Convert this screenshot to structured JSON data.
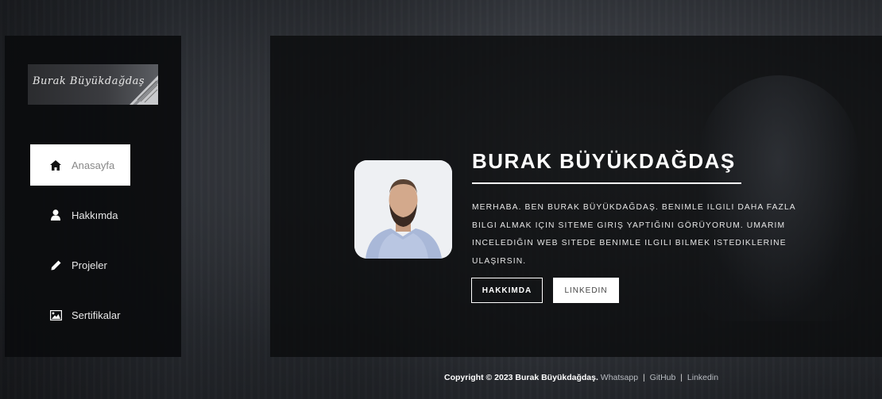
{
  "sidebar": {
    "logo_text": "Burak Büyükdağdaş",
    "items": [
      {
        "label": "Anasayfa",
        "icon": "home-icon",
        "active": true
      },
      {
        "label": "Hakkımda",
        "icon": "user-icon",
        "active": false
      },
      {
        "label": "Projeler",
        "icon": "pencil-icon",
        "active": false
      },
      {
        "label": "Sertifikalar",
        "icon": "image-icon",
        "active": false
      }
    ]
  },
  "hero": {
    "name": "BURAK BÜYÜKDAĞDAŞ",
    "description": "MERHABA. BEN BURAK BÜYÜKDAĞDAŞ. BENIMLE ILGILI DAHA FAZLA BILGI ALMAK IÇIN SITEME GIRIŞ YAPTIĞINI GÖRÜYORUM. UMARIM INCELEDIĞIN WEB SITEDE BENIMLE ILGILI BILMEK ISTEDIKLERINE ULAŞIRSIN.",
    "buttons": {
      "about": "HAKKIMDA",
      "linkedin": "LINKEDIN"
    }
  },
  "footer": {
    "copyright": "Copyright © 2023 Burak Büyükdağdaş.",
    "links": [
      "Whatsapp",
      "GitHub",
      "Linkedin"
    ],
    "separator": "|"
  },
  "colors": {
    "sidebar_bg": "#0b0c0e",
    "active_item_bg": "#ffffff",
    "accent": "#ffffff"
  }
}
